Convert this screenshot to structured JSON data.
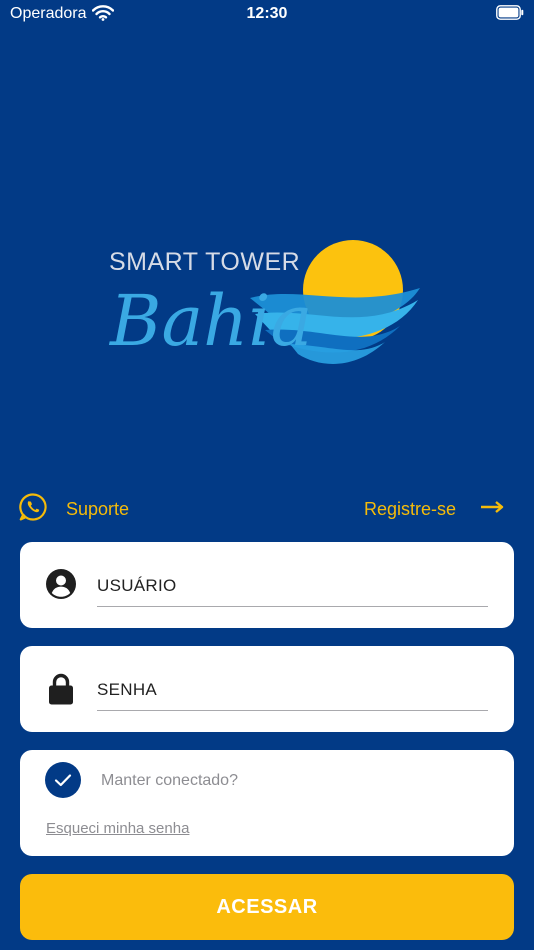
{
  "status_bar": {
    "carrier": "Operadora",
    "time": "12:30",
    "icons": [
      "wifi-icon",
      "battery-icon"
    ]
  },
  "logo": {
    "line1": "SMART TOWER",
    "line2": "Bahia"
  },
  "links": {
    "support": "Suporte",
    "support_icon": "whatsapp-icon",
    "register": "Registre-se",
    "register_icon": "arrow-right-icon"
  },
  "form": {
    "username_placeholder": "USUÁRIO",
    "username_value": "",
    "username_icon": "user-circle-icon",
    "password_placeholder": "SENHA",
    "password_value": "",
    "password_icon": "lock-icon",
    "keep_connected": "Manter conectado?",
    "keep_connected_checked": true,
    "forgot_password": "Esqueci minha senha",
    "submit": "ACESSAR"
  },
  "colors": {
    "background": "#023a86",
    "accent": "#fbbc0c",
    "link": "#f5bb0a",
    "card": "#ffffff",
    "muted_text": "#8d8d92"
  }
}
